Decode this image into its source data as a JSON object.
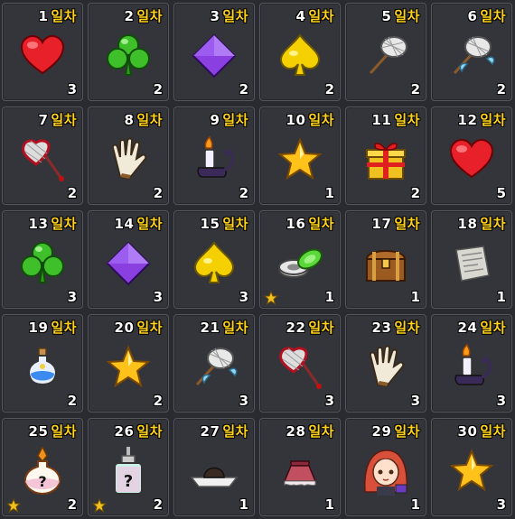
{
  "day_suffix": "일차",
  "items": [
    {
      "day": "1",
      "qty": "3",
      "icon": "heart-icon",
      "star": false
    },
    {
      "day": "2",
      "qty": "2",
      "icon": "clover-icon",
      "star": false
    },
    {
      "day": "3",
      "qty": "2",
      "icon": "diamond-icon",
      "star": false
    },
    {
      "day": "4",
      "qty": "2",
      "icon": "spade-icon",
      "star": false
    },
    {
      "day": "5",
      "qty": "2",
      "icon": "bug-net-icon",
      "star": false
    },
    {
      "day": "6",
      "qty": "2",
      "icon": "winged-bug-net-icon",
      "star": false
    },
    {
      "day": "7",
      "qty": "2",
      "icon": "heart-bug-net-icon",
      "star": false
    },
    {
      "day": "8",
      "qty": "2",
      "icon": "glove-icon",
      "star": false
    },
    {
      "day": "9",
      "qty": "2",
      "icon": "candle-icon",
      "star": false
    },
    {
      "day": "10",
      "qty": "1",
      "icon": "star-icon",
      "star": false
    },
    {
      "day": "11",
      "qty": "2",
      "icon": "gift-box-icon",
      "star": false
    },
    {
      "day": "12",
      "qty": "5",
      "icon": "heart-icon",
      "star": false
    },
    {
      "day": "13",
      "qty": "3",
      "icon": "clover-icon",
      "star": false
    },
    {
      "day": "14",
      "qty": "3",
      "icon": "diamond-icon",
      "star": false
    },
    {
      "day": "15",
      "qty": "3",
      "icon": "spade-icon",
      "star": false
    },
    {
      "day": "16",
      "qty": "1",
      "icon": "ring-disks-icon",
      "star": true
    },
    {
      "day": "17",
      "qty": "1",
      "icon": "treasure-chest-icon",
      "star": false
    },
    {
      "day": "18",
      "qty": "1",
      "icon": "scroll-letter-icon",
      "star": false
    },
    {
      "day": "19",
      "qty": "2",
      "icon": "potion-bottle-icon",
      "star": false
    },
    {
      "day": "20",
      "qty": "2",
      "icon": "star-icon",
      "star": false
    },
    {
      "day": "21",
      "qty": "3",
      "icon": "winged-bug-net-icon",
      "star": false
    },
    {
      "day": "22",
      "qty": "3",
      "icon": "heart-bug-net-icon",
      "star": false
    },
    {
      "day": "23",
      "qty": "3",
      "icon": "glove-icon",
      "star": false
    },
    {
      "day": "24",
      "qty": "3",
      "icon": "candle-icon",
      "star": false
    },
    {
      "day": "25",
      "qty": "2",
      "icon": "mystery-flask-icon",
      "star": true
    },
    {
      "day": "26",
      "qty": "2",
      "icon": "mystery-dye-bottle-icon",
      "star": true
    },
    {
      "day": "27",
      "qty": "1",
      "icon": "hat-icon",
      "star": false
    },
    {
      "day": "28",
      "qty": "1",
      "icon": "skirt-icon",
      "star": false
    },
    {
      "day": "29",
      "qty": "1",
      "icon": "character-portrait-icon",
      "star": false
    },
    {
      "day": "30",
      "qty": "3",
      "icon": "star-icon",
      "star": false
    }
  ],
  "colors": {
    "background": "#2a2b30",
    "cell": "#34353b",
    "day_number": "#ffffff",
    "day_suffix": "#ffd21a"
  }
}
